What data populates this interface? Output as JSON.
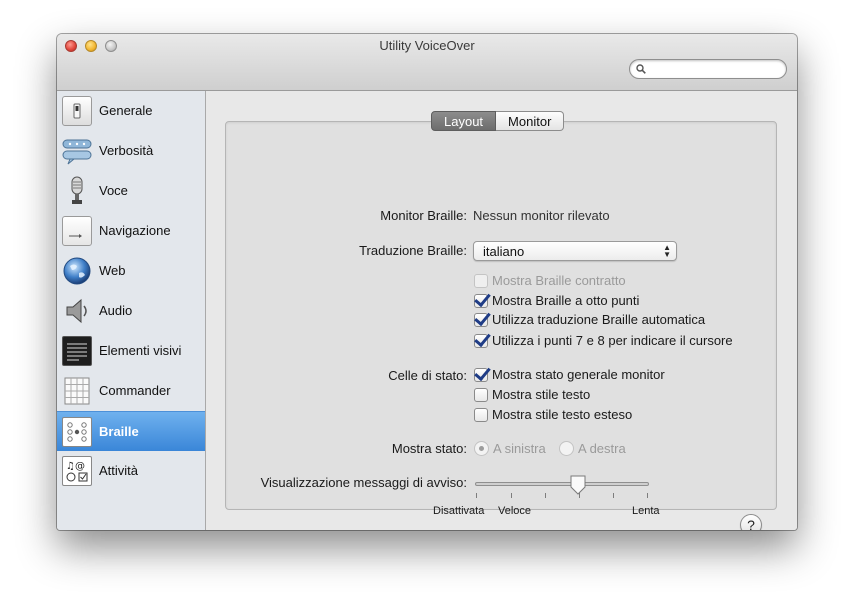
{
  "window": {
    "title": "Utility VoiceOver",
    "search_placeholder": ""
  },
  "sidebar": {
    "items": [
      {
        "label": "Generale",
        "icon": "switch-icon"
      },
      {
        "label": "Verbosità",
        "icon": "speech-bubbles-icon"
      },
      {
        "label": "Voce",
        "icon": "microphone-icon"
      },
      {
        "label": "Navigazione",
        "icon": "arrow-key-icon"
      },
      {
        "label": "Web",
        "icon": "globe-icon"
      },
      {
        "label": "Audio",
        "icon": "speaker-icon"
      },
      {
        "label": "Elementi visivi",
        "icon": "screen-icon"
      },
      {
        "label": "Commander",
        "icon": "keypad-icon"
      },
      {
        "label": "Braille",
        "icon": "braille-icon",
        "selected": true
      },
      {
        "label": "Attività",
        "icon": "activities-icon"
      }
    ]
  },
  "tabs": [
    {
      "label": "Layout",
      "active": true
    },
    {
      "label": "Monitor",
      "active": false
    }
  ],
  "form": {
    "monitor_label": "Monitor Braille:",
    "monitor_value": "Nessun monitor rilevato",
    "translation_label": "Traduzione Braille:",
    "translation_value": "italiano",
    "options": [
      {
        "label": "Mostra Braille contratto",
        "checked": false,
        "disabled": true
      },
      {
        "label": "Mostra Braille a otto punti",
        "checked": true,
        "disabled": false
      },
      {
        "label": "Utilizza traduzione Braille automatica",
        "checked": true,
        "disabled": false
      },
      {
        "label": "Utilizza i punti 7 e 8 per indicare il cursore",
        "checked": true,
        "disabled": false
      }
    ],
    "status_cells_label": "Celle di stato:",
    "status_cells": [
      {
        "label": "Mostra stato generale monitor",
        "checked": true
      },
      {
        "label": "Mostra stile testo",
        "checked": false
      },
      {
        "label": "Mostra stile testo esteso",
        "checked": false
      }
    ],
    "show_status_label": "Mostra stato:",
    "show_status_options": [
      {
        "label": "A sinistra",
        "selected": true
      },
      {
        "label": "A destra",
        "selected": false
      }
    ],
    "alert_label": "Visualizzazione messaggi di avviso:",
    "slider_labels": {
      "off": "Disattivata",
      "fast": "Veloce",
      "slow": "Lenta"
    },
    "slider_value_fraction": 0.5,
    "help_label": "?"
  },
  "colors": {
    "selection": "#3a86d8",
    "checkmark": "#1f3c86"
  }
}
